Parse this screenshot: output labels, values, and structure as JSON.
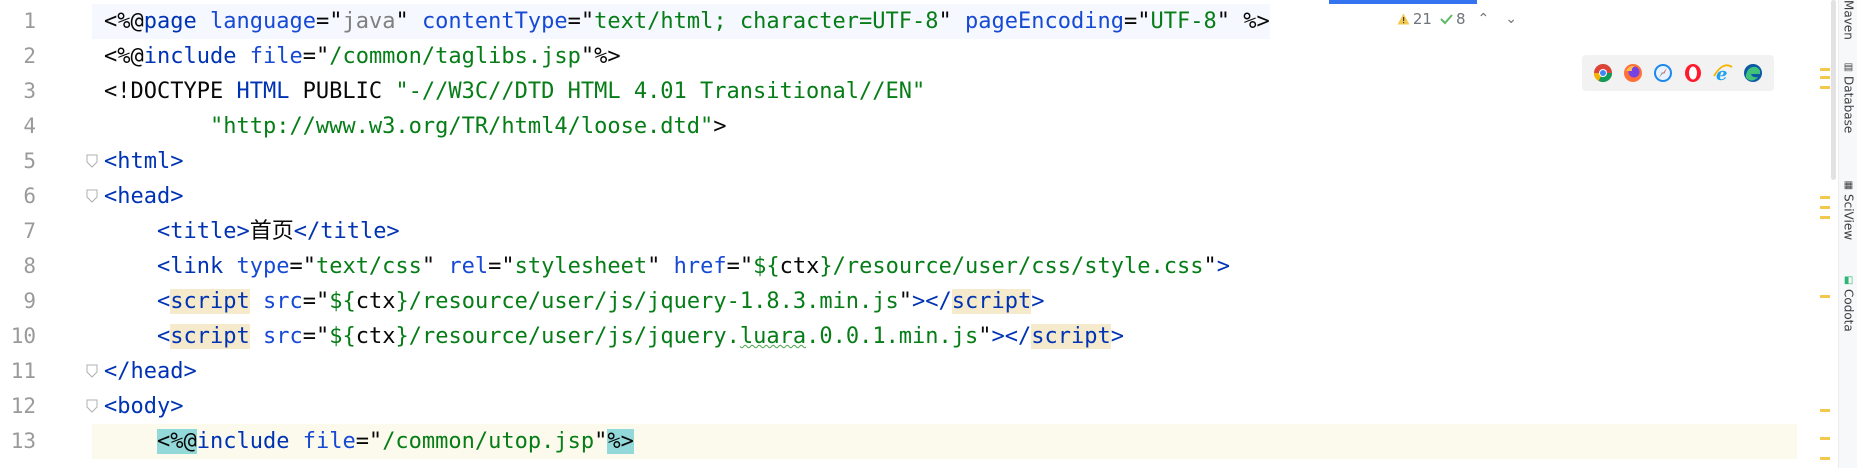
{
  "editor": {
    "line_numbers": [
      "1",
      "2",
      "3",
      "4",
      "5",
      "6",
      "7",
      "8",
      "9",
      "10",
      "11",
      "12",
      "13"
    ],
    "current_line": "13",
    "lines": [
      [
        {
          "t": "<%@",
          "c": "pct"
        },
        {
          "t": "page",
          "c": "dir"
        },
        {
          "t": " "
        },
        {
          "t": "language",
          "c": "attr"
        },
        {
          "t": "=\""
        },
        {
          "t": "java",
          "c": "dim"
        },
        {
          "t": "\" "
        },
        {
          "t": "contentType",
          "c": "attr"
        },
        {
          "t": "=\""
        },
        {
          "t": "text/html; character=UTF-8",
          "c": "str"
        },
        {
          "t": "\" "
        },
        {
          "t": "pageEncoding",
          "c": "attr"
        },
        {
          "t": "=\""
        },
        {
          "t": "UTF-8",
          "c": "str"
        },
        {
          "t": "\" "
        },
        {
          "t": "%>",
          "c": "pct"
        }
      ],
      [
        {
          "t": "<%@",
          "c": "pct"
        },
        {
          "t": "include",
          "c": "dir"
        },
        {
          "t": " "
        },
        {
          "t": "file",
          "c": "attr"
        },
        {
          "t": "=\""
        },
        {
          "t": "/common/taglibs.jsp",
          "c": "str"
        },
        {
          "t": "\""
        },
        {
          "t": "%>",
          "c": "pct"
        }
      ],
      [
        {
          "t": "<!DOCTYPE ",
          "c": "plain"
        },
        {
          "t": "HTML",
          "c": "tag"
        },
        {
          "t": " PUBLIC ",
          "c": "plain"
        },
        {
          "t": "\"-//W3C//DTD HTML 4.01 Transitional//EN\"",
          "c": "str"
        }
      ],
      [
        {
          "t": "        "
        },
        {
          "t": "\"http://www.w3.org/TR/html4/loose.dtd\"",
          "c": "str"
        },
        {
          "t": ">",
          "c": "plain"
        }
      ],
      [
        {
          "t": "<html>",
          "c": "tag"
        }
      ],
      [
        {
          "t": "<head>",
          "c": "tag"
        }
      ],
      [
        {
          "t": "    "
        },
        {
          "t": "<title>",
          "c": "tag"
        },
        {
          "t": "首页",
          "c": "plain"
        },
        {
          "t": "</title>",
          "c": "tag"
        }
      ],
      [
        {
          "t": "    "
        },
        {
          "t": "<link ",
          "c": "tag"
        },
        {
          "t": "type",
          "c": "attr"
        },
        {
          "t": "=\""
        },
        {
          "t": "text/css",
          "c": "str"
        },
        {
          "t": "\" "
        },
        {
          "t": "rel",
          "c": "attr"
        },
        {
          "t": "=\""
        },
        {
          "t": "stylesheet",
          "c": "str"
        },
        {
          "t": "\" "
        },
        {
          "t": "href",
          "c": "attr"
        },
        {
          "t": "=\""
        },
        {
          "t": "${",
          "c": "str"
        },
        {
          "t": "ctx",
          "c": "plain"
        },
        {
          "t": "}",
          "c": "str"
        },
        {
          "t": "/resource/user/css/style.css",
          "c": "str"
        },
        {
          "t": "\""
        },
        {
          "t": ">",
          "c": "tag"
        }
      ],
      [
        {
          "t": "    "
        },
        {
          "t": "<",
          "c": "tag"
        },
        {
          "t": "script",
          "c": "tag",
          "hl": true
        },
        {
          "t": " "
        },
        {
          "t": "src",
          "c": "attr"
        },
        {
          "t": "=\""
        },
        {
          "t": "${",
          "c": "str"
        },
        {
          "t": "ctx",
          "c": "plain"
        },
        {
          "t": "}",
          "c": "str"
        },
        {
          "t": "/resource/user/js/jquery-1.8.3.min.js",
          "c": "str"
        },
        {
          "t": "\""
        },
        {
          "t": "></",
          "c": "tag"
        },
        {
          "t": "script",
          "c": "tag",
          "hl": true
        },
        {
          "t": ">",
          "c": "tag"
        }
      ],
      [
        {
          "t": "    "
        },
        {
          "t": "<",
          "c": "tag"
        },
        {
          "t": "script",
          "c": "tag",
          "hl": true
        },
        {
          "t": " "
        },
        {
          "t": "src",
          "c": "attr"
        },
        {
          "t": "=\""
        },
        {
          "t": "${",
          "c": "str"
        },
        {
          "t": "ctx",
          "c": "plain"
        },
        {
          "t": "}",
          "c": "str"
        },
        {
          "t": "/resource/user/js/jquery.",
          "c": "str"
        },
        {
          "t": "luara",
          "c": "str",
          "u": true
        },
        {
          "t": ".0.0.1.min.js",
          "c": "str"
        },
        {
          "t": "\""
        },
        {
          "t": "></",
          "c": "tag"
        },
        {
          "t": "script",
          "c": "tag",
          "hl": true
        },
        {
          "t": ">",
          "c": "tag"
        }
      ],
      [
        {
          "t": "</head>",
          "c": "tag"
        }
      ],
      [
        {
          "t": "<body>",
          "c": "tag"
        }
      ],
      [
        {
          "t": "    "
        },
        {
          "t": "<%@",
          "c": "pct",
          "m": true
        },
        {
          "t": "include",
          "c": "dir"
        },
        {
          "t": " "
        },
        {
          "t": "file",
          "c": "attr"
        },
        {
          "t": "=\""
        },
        {
          "t": "/common/utop.jsp",
          "c": "str"
        },
        {
          "t": "\""
        },
        {
          "t": "%>",
          "c": "pct",
          "m": true
        }
      ]
    ]
  },
  "inspection": {
    "warnings": "21",
    "weak_warnings": "8"
  },
  "browsers": [
    "chrome-icon",
    "firefox-icon",
    "safari-icon",
    "opera-icon",
    "ie-icon",
    "edge-icon"
  ],
  "right_tabs": [
    "Maven",
    "Database",
    "SciView",
    "Codota"
  ],
  "colors": {
    "accent": "#3574f0",
    "current_line": "#fcfaed",
    "tag": "#0033b3",
    "string": "#067d17"
  }
}
